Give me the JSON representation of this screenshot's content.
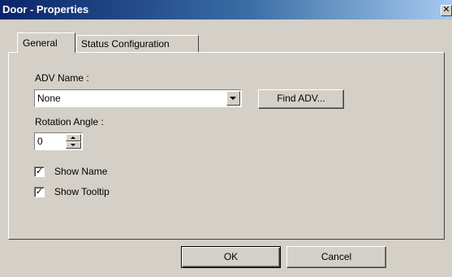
{
  "window": {
    "title": "Door - Properties",
    "close_glyph": "✕"
  },
  "tabs": [
    {
      "label": "General",
      "active": true
    },
    {
      "label": "Status Configuration",
      "active": false
    }
  ],
  "general": {
    "adv_name_label": "ADV Name :",
    "adv_name_value": "None",
    "find_adv_button": "Find ADV...",
    "rotation_label": "Rotation Angle :",
    "rotation_value": "0",
    "show_name_label": "Show Name",
    "show_name_checked": true,
    "show_tooltip_label": "Show Tooltip",
    "show_tooltip_checked": true,
    "check_glyph": "✓"
  },
  "footer": {
    "ok_label": "OK",
    "cancel_label": "Cancel"
  },
  "colors": {
    "face": "#d4d0c8",
    "title_start": "#0a246a",
    "title_end": "#a6caf0"
  }
}
